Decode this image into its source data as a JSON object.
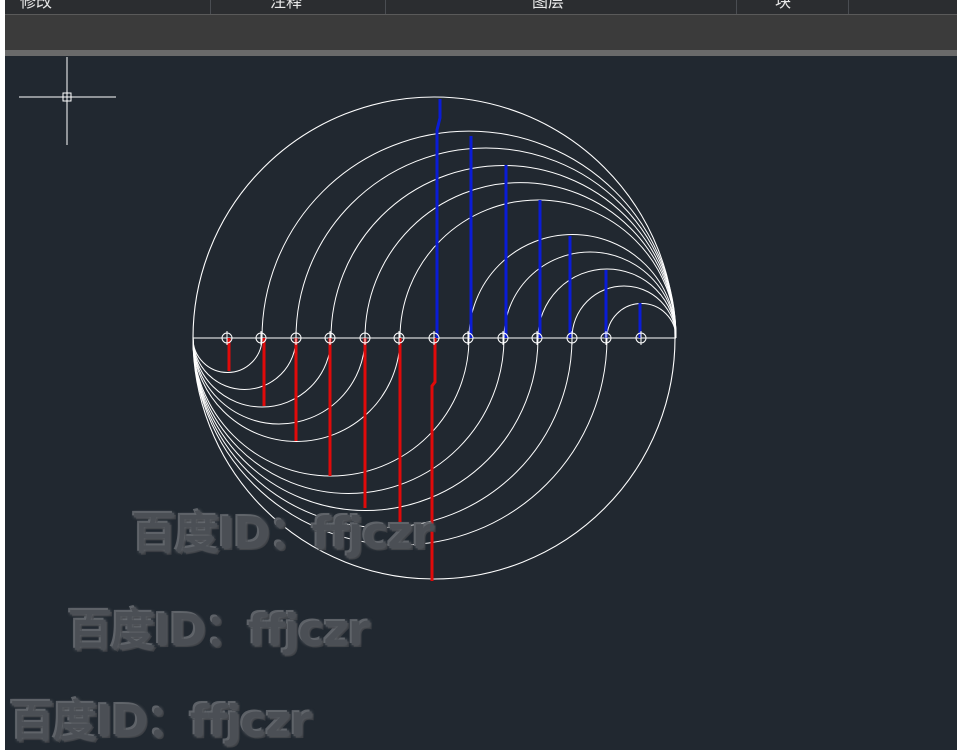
{
  "menubar": {
    "items": [
      "修改",
      "注释",
      "图层",
      "块"
    ]
  },
  "watermarks": [
    "百度ID：ffjczr",
    "百度ID：ffjczr",
    "百度ID：ffjczr"
  ],
  "colors": {
    "canvas_bg": "#212830",
    "geometry": "#ffffff",
    "upper_lines": "#0a1cd6",
    "lower_lines": "#e00a0a"
  },
  "icons": {
    "crosshair": "crosshair-cursor-icon"
  }
}
